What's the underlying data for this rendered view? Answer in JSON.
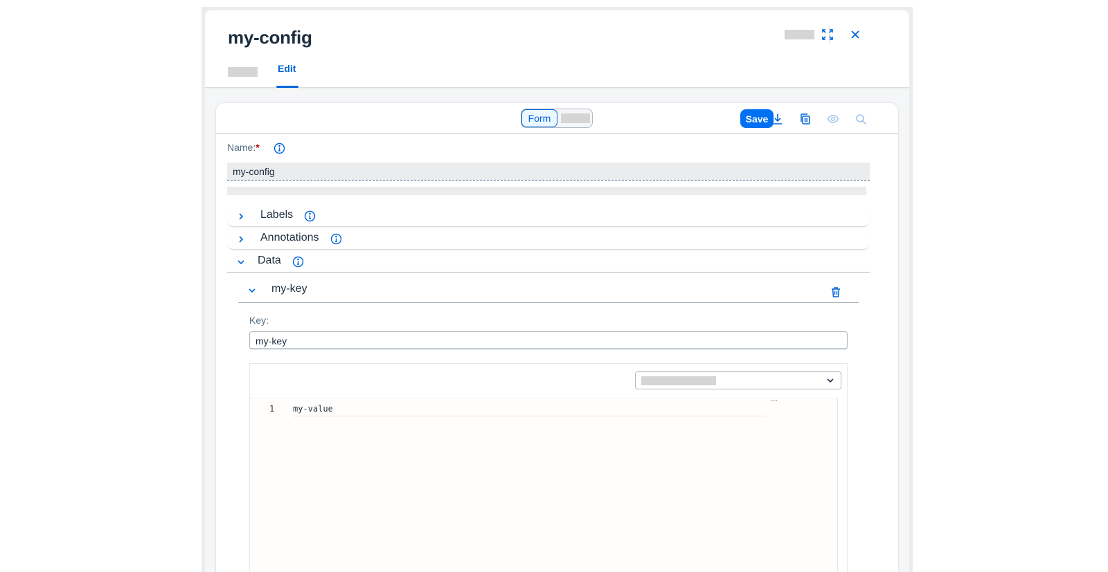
{
  "app": {
    "title": "my-config",
    "tabs": [
      {
        "label": "",
        "active": false
      },
      {
        "label": "Edit",
        "active": true
      }
    ]
  },
  "toolbar": {
    "mode_form_label": "Form",
    "save_label": "Save"
  },
  "form": {
    "name_label": "Name:",
    "required_marker": "*",
    "name_value": "my-config",
    "sections": [
      {
        "label": "Labels",
        "expanded": false
      },
      {
        "label": "Annotations",
        "expanded": false
      },
      {
        "label": "Data",
        "expanded": true
      }
    ],
    "data_entry": {
      "title": "my-key",
      "key_label": "Key:",
      "key_value": "my-key",
      "editor": {
        "line_number": "1",
        "line_text": "my-value",
        "ellipsis": "…"
      }
    }
  },
  "colors": {
    "accent": "#0064d9",
    "save_button": "#0070f2",
    "required": "#aa0808"
  },
  "icons": [
    "fullscreen-icon",
    "close-icon",
    "download-icon",
    "copy-icon",
    "eye-icon",
    "search-icon",
    "info-icon",
    "chevron-right-icon",
    "chevron-down-icon",
    "trash-icon"
  ]
}
